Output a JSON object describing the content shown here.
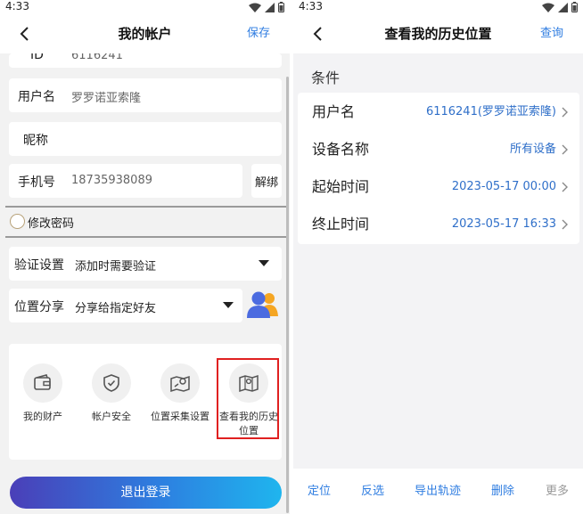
{
  "left": {
    "status_time": "4:33",
    "title": "我的帐户",
    "save": "保存",
    "id_label": "ID",
    "id_value": "6116241",
    "username_label": "用户名",
    "username_value": "罗罗诺亚索隆",
    "nickname_label": "昵称",
    "phone_label": "手机号",
    "phone_value": "18735938089",
    "unbind": "解绑",
    "change_password": "修改密码",
    "verify_label": "验证设置",
    "verify_value": "添加时需要验证",
    "share_label": "位置分享",
    "share_value": "分享给指定好友",
    "grid": [
      {
        "label": "我的财产"
      },
      {
        "label": "帐户安全"
      },
      {
        "label": "位置采集设置"
      },
      {
        "label": "查看我的历史位置"
      }
    ],
    "logout": "退出登录"
  },
  "right": {
    "status_time": "4:33",
    "title": "查看我的历史位置",
    "query": "查询",
    "conditions_title": "条件",
    "rows": [
      {
        "key": "用户名",
        "value": "6116241(罗罗诺亚索隆)"
      },
      {
        "key": "设备名称",
        "value": "所有设备"
      },
      {
        "key": "起始时间",
        "value": "2023-05-17 00:00"
      },
      {
        "key": "终止时间",
        "value": "2023-05-17 16:33"
      }
    ],
    "bottom": {
      "locate": "定位",
      "invert": "反选",
      "export": "导出轨迹",
      "delete": "删除",
      "more": "更多"
    }
  },
  "colors": {
    "accent": "#2f7de1",
    "highlight_box": "#e02020",
    "share_icon_blue": "#4b6be0",
    "share_icon_orange": "#f5a623"
  }
}
